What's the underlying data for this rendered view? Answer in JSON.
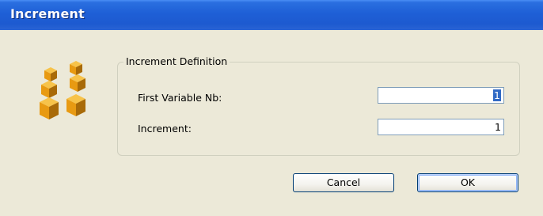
{
  "window": {
    "title": "Increment"
  },
  "icon": {
    "name": "increment-cubes-icon",
    "color": "#f0a020"
  },
  "group": {
    "legend": "Increment Definition",
    "fields": [
      {
        "label": "First Variable Nb:",
        "value": "1",
        "selected": true
      },
      {
        "label": "Increment:",
        "value": "1",
        "selected": false
      }
    ]
  },
  "buttons": {
    "cancel": "Cancel",
    "ok": "OK"
  }
}
